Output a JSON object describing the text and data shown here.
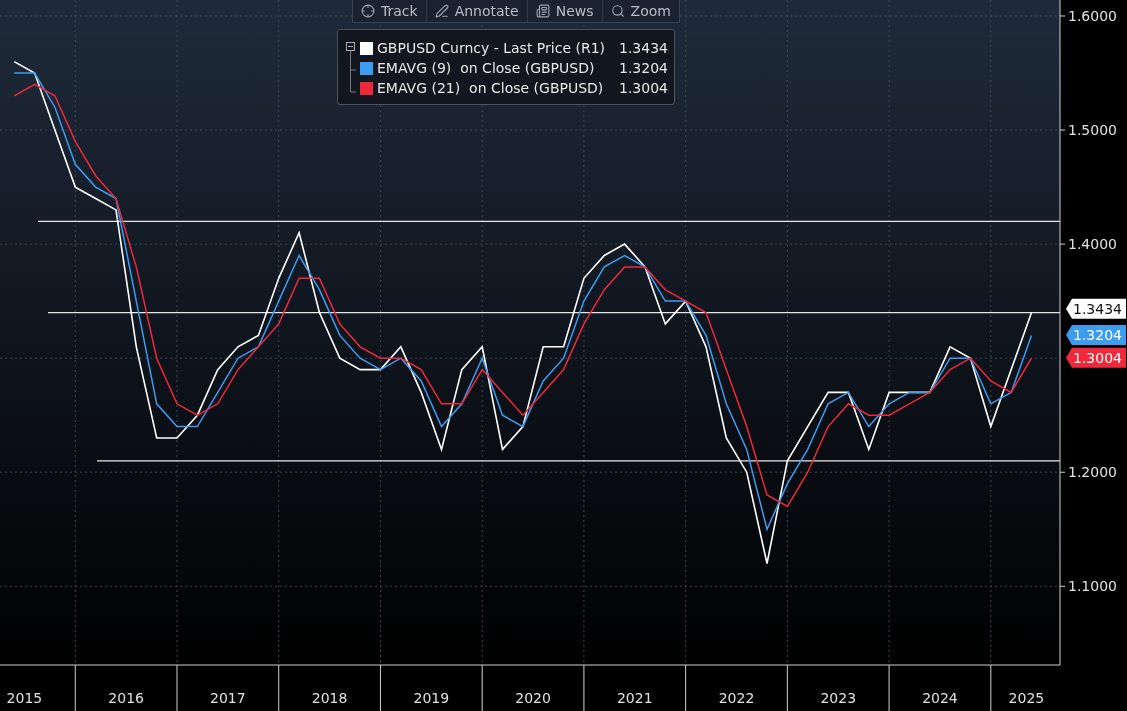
{
  "toolbar": [
    {
      "kind": "track",
      "label": "Track"
    },
    {
      "kind": "annotate",
      "label": "Annotate"
    },
    {
      "kind": "news",
      "label": "News"
    },
    {
      "kind": "zoom",
      "label": "Zoom"
    }
  ],
  "legend_readings": [
    "1.3434",
    "1.3204",
    "1.3004"
  ],
  "price_tags": [
    {
      "text": "1.3434",
      "color": "#ffffff"
    },
    {
      "text": "1.3204",
      "color": "#3d9cf0"
    },
    {
      "text": "1.3004",
      "color": "#f0283c"
    }
  ],
  "chart_data": {
    "type": "line",
    "x": [
      2015.4,
      2015.6,
      2015.8,
      2016.0,
      2016.2,
      2016.4,
      2016.6,
      2016.8,
      2017.0,
      2017.2,
      2017.4,
      2017.6,
      2017.8,
      2018.0,
      2018.2,
      2018.4,
      2018.6,
      2018.8,
      2019.0,
      2019.2,
      2019.4,
      2019.6,
      2019.8,
      2020.0,
      2020.2,
      2020.4,
      2020.6,
      2020.8,
      2021.0,
      2021.2,
      2021.4,
      2021.6,
      2021.8,
      2022.0,
      2022.2,
      2022.4,
      2022.6,
      2022.8,
      2023.0,
      2023.2,
      2023.4,
      2023.6,
      2023.8,
      2024.0,
      2024.2,
      2024.4,
      2024.6,
      2024.8,
      2025.0,
      2025.2,
      2025.4
    ],
    "series": [
      {
        "name": "GBPUSD Curncy - Last Price (R1)",
        "color": "#ffffff",
        "values": [
          1.56,
          1.55,
          1.5,
          1.45,
          1.44,
          1.43,
          1.31,
          1.23,
          1.23,
          1.25,
          1.29,
          1.31,
          1.32,
          1.37,
          1.41,
          1.34,
          1.3,
          1.29,
          1.29,
          1.31,
          1.27,
          1.22,
          1.29,
          1.31,
          1.22,
          1.24,
          1.31,
          1.31,
          1.37,
          1.39,
          1.4,
          1.38,
          1.33,
          1.35,
          1.31,
          1.23,
          1.2,
          1.12,
          1.21,
          1.24,
          1.27,
          1.27,
          1.22,
          1.27,
          1.27,
          1.27,
          1.31,
          1.3,
          1.24,
          1.29,
          1.34
        ]
      },
      {
        "name": "EMAVG (9)  on Close (GBPUSD)",
        "color": "#3d9cf0",
        "values": [
          1.55,
          1.55,
          1.52,
          1.47,
          1.45,
          1.44,
          1.35,
          1.26,
          1.24,
          1.24,
          1.27,
          1.3,
          1.31,
          1.35,
          1.39,
          1.36,
          1.32,
          1.3,
          1.29,
          1.3,
          1.28,
          1.24,
          1.26,
          1.3,
          1.25,
          1.24,
          1.28,
          1.3,
          1.35,
          1.38,
          1.39,
          1.38,
          1.35,
          1.35,
          1.32,
          1.26,
          1.22,
          1.15,
          1.19,
          1.22,
          1.26,
          1.27,
          1.24,
          1.26,
          1.27,
          1.27,
          1.3,
          1.3,
          1.26,
          1.27,
          1.32
        ]
      },
      {
        "name": "EMAVG (21)  on Close (GBPUSD)",
        "color": "#f0283c",
        "values": [
          1.53,
          1.54,
          1.53,
          1.49,
          1.46,
          1.44,
          1.38,
          1.3,
          1.26,
          1.25,
          1.26,
          1.29,
          1.31,
          1.33,
          1.37,
          1.37,
          1.33,
          1.31,
          1.3,
          1.3,
          1.29,
          1.26,
          1.26,
          1.29,
          1.27,
          1.25,
          1.27,
          1.29,
          1.33,
          1.36,
          1.38,
          1.38,
          1.36,
          1.35,
          1.34,
          1.29,
          1.24,
          1.18,
          1.17,
          1.2,
          1.24,
          1.26,
          1.25,
          1.25,
          1.26,
          1.27,
          1.29,
          1.3,
          1.28,
          1.27,
          1.3
        ]
      }
    ],
    "xlim": [
      2015.26,
      2025.68
    ],
    "ylim": [
      1.031,
      1.614
    ],
    "xticks": [
      {
        "value": 2015.5,
        "label": "2015"
      },
      {
        "value": 2016.5,
        "label": "2016"
      },
      {
        "value": 2017.5,
        "label": "2017"
      },
      {
        "value": 2018.5,
        "label": "2018"
      },
      {
        "value": 2019.5,
        "label": "2019"
      },
      {
        "value": 2020.5,
        "label": "2020"
      },
      {
        "value": 2021.5,
        "label": "2021"
      },
      {
        "value": 2022.5,
        "label": "2022"
      },
      {
        "value": 2023.5,
        "label": "2023"
      },
      {
        "value": 2024.5,
        "label": "2024"
      },
      {
        "value": 2025.35,
        "label": "2025"
      }
    ],
    "yticks": [
      {
        "value": 1.1,
        "label": "1.1000"
      },
      {
        "value": 1.2,
        "label": "1.2000"
      },
      {
        "value": 1.4,
        "label": "1.4000"
      },
      {
        "value": 1.5,
        "label": "1.5000"
      },
      {
        "value": 1.6,
        "label": "1.6000"
      }
    ],
    "grid": true,
    "ref_lines": [
      {
        "axis": "y",
        "value": 1.42
      },
      {
        "axis": "y",
        "value": 1.34
      },
      {
        "axis": "y",
        "value": 1.21
      }
    ]
  }
}
